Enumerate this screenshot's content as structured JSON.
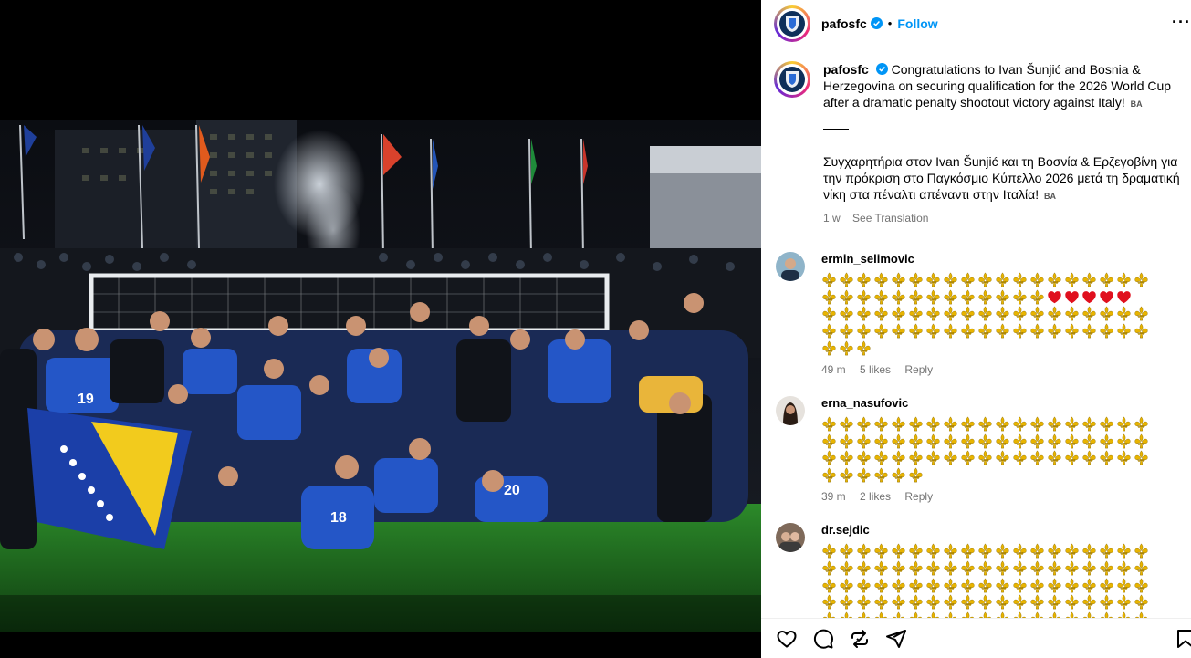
{
  "post": {
    "username": "pafosfc",
    "follow_label": "Follow",
    "separator": "•",
    "more_label": "···",
    "caption_en": "Congratulations to Ivan Šunjić and Bosnia & Herzegovina on securing qualification for the 2026 World Cup after a dramatic penalty shootout victory against Italy!",
    "caption_flag": "BA",
    "divider": "____",
    "caption_gr": "Συγχαρητήρια στον Ivan Šunjić και τη Βοσνία & Ερζεγοβίνη για την πρόκριση στο Παγκόσμιο Κύπελλο 2026 μετά τη δραματική νίκη στα πέναλτι απέναντι στην Ιταλία!",
    "caption_gr_flag": "BA",
    "time": "1 w",
    "see_translation": "See Translation"
  },
  "comments": [
    {
      "username": "ermin_selimovic",
      "emoji_sequence": "19 lily, 13 lily + 5 heart, 19 lily, 19 lily, 3 lily",
      "rows": [
        19,
        13,
        19,
        19,
        3
      ],
      "hearts_on_row": 1,
      "hearts": 5,
      "time": "49 m",
      "likes": "5 likes",
      "reply": "Reply"
    },
    {
      "username": "erna_nasufovic",
      "rows": [
        19,
        19,
        19,
        6
      ],
      "time": "39 m",
      "likes": "2 likes",
      "reply": "Reply"
    },
    {
      "username": "dr.sejdic",
      "rows": [
        19,
        19,
        19,
        19,
        19
      ],
      "time": "",
      "likes": "",
      "reply": ""
    }
  ],
  "colors": {
    "follow": "#0095f6",
    "muted": "#737373",
    "lily": "#e8b400",
    "heart": "#e0101e",
    "pitch": "#2f8f2a",
    "kit": "#1f4fc4"
  },
  "icons": [
    "heart-icon",
    "comment-icon",
    "repost-icon",
    "share-icon",
    "save-icon",
    "verified-icon",
    "more-icon"
  ]
}
